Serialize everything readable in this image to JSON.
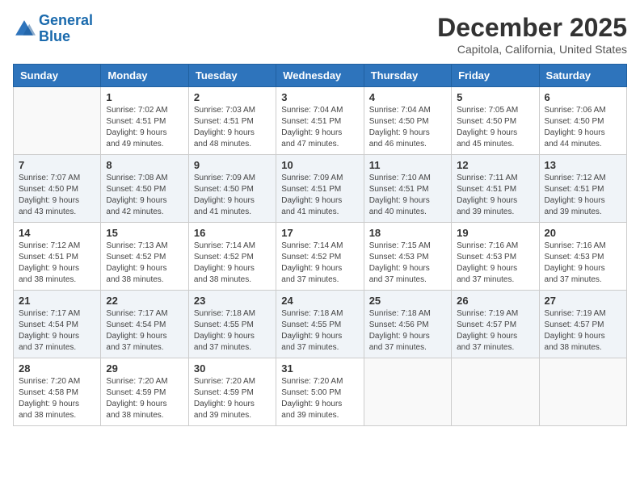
{
  "logo": {
    "line1": "General",
    "line2": "Blue"
  },
  "title": "December 2025",
  "subtitle": "Capitola, California, United States",
  "weekdays": [
    "Sunday",
    "Monday",
    "Tuesday",
    "Wednesday",
    "Thursday",
    "Friday",
    "Saturday"
  ],
  "weeks": [
    [
      {
        "day": "",
        "info": ""
      },
      {
        "day": "1",
        "info": "Sunrise: 7:02 AM\nSunset: 4:51 PM\nDaylight: 9 hours\nand 49 minutes."
      },
      {
        "day": "2",
        "info": "Sunrise: 7:03 AM\nSunset: 4:51 PM\nDaylight: 9 hours\nand 48 minutes."
      },
      {
        "day": "3",
        "info": "Sunrise: 7:04 AM\nSunset: 4:51 PM\nDaylight: 9 hours\nand 47 minutes."
      },
      {
        "day": "4",
        "info": "Sunrise: 7:04 AM\nSunset: 4:50 PM\nDaylight: 9 hours\nand 46 minutes."
      },
      {
        "day": "5",
        "info": "Sunrise: 7:05 AM\nSunset: 4:50 PM\nDaylight: 9 hours\nand 45 minutes."
      },
      {
        "day": "6",
        "info": "Sunrise: 7:06 AM\nSunset: 4:50 PM\nDaylight: 9 hours\nand 44 minutes."
      }
    ],
    [
      {
        "day": "7",
        "info": "Sunrise: 7:07 AM\nSunset: 4:50 PM\nDaylight: 9 hours\nand 43 minutes."
      },
      {
        "day": "8",
        "info": "Sunrise: 7:08 AM\nSunset: 4:50 PM\nDaylight: 9 hours\nand 42 minutes."
      },
      {
        "day": "9",
        "info": "Sunrise: 7:09 AM\nSunset: 4:50 PM\nDaylight: 9 hours\nand 41 minutes."
      },
      {
        "day": "10",
        "info": "Sunrise: 7:09 AM\nSunset: 4:51 PM\nDaylight: 9 hours\nand 41 minutes."
      },
      {
        "day": "11",
        "info": "Sunrise: 7:10 AM\nSunset: 4:51 PM\nDaylight: 9 hours\nand 40 minutes."
      },
      {
        "day": "12",
        "info": "Sunrise: 7:11 AM\nSunset: 4:51 PM\nDaylight: 9 hours\nand 39 minutes."
      },
      {
        "day": "13",
        "info": "Sunrise: 7:12 AM\nSunset: 4:51 PM\nDaylight: 9 hours\nand 39 minutes."
      }
    ],
    [
      {
        "day": "14",
        "info": "Sunrise: 7:12 AM\nSunset: 4:51 PM\nDaylight: 9 hours\nand 38 minutes."
      },
      {
        "day": "15",
        "info": "Sunrise: 7:13 AM\nSunset: 4:52 PM\nDaylight: 9 hours\nand 38 minutes."
      },
      {
        "day": "16",
        "info": "Sunrise: 7:14 AM\nSunset: 4:52 PM\nDaylight: 9 hours\nand 38 minutes."
      },
      {
        "day": "17",
        "info": "Sunrise: 7:14 AM\nSunset: 4:52 PM\nDaylight: 9 hours\nand 37 minutes."
      },
      {
        "day": "18",
        "info": "Sunrise: 7:15 AM\nSunset: 4:53 PM\nDaylight: 9 hours\nand 37 minutes."
      },
      {
        "day": "19",
        "info": "Sunrise: 7:16 AM\nSunset: 4:53 PM\nDaylight: 9 hours\nand 37 minutes."
      },
      {
        "day": "20",
        "info": "Sunrise: 7:16 AM\nSunset: 4:53 PM\nDaylight: 9 hours\nand 37 minutes."
      }
    ],
    [
      {
        "day": "21",
        "info": "Sunrise: 7:17 AM\nSunset: 4:54 PM\nDaylight: 9 hours\nand 37 minutes."
      },
      {
        "day": "22",
        "info": "Sunrise: 7:17 AM\nSunset: 4:54 PM\nDaylight: 9 hours\nand 37 minutes."
      },
      {
        "day": "23",
        "info": "Sunrise: 7:18 AM\nSunset: 4:55 PM\nDaylight: 9 hours\nand 37 minutes."
      },
      {
        "day": "24",
        "info": "Sunrise: 7:18 AM\nSunset: 4:55 PM\nDaylight: 9 hours\nand 37 minutes."
      },
      {
        "day": "25",
        "info": "Sunrise: 7:18 AM\nSunset: 4:56 PM\nDaylight: 9 hours\nand 37 minutes."
      },
      {
        "day": "26",
        "info": "Sunrise: 7:19 AM\nSunset: 4:57 PM\nDaylight: 9 hours\nand 37 minutes."
      },
      {
        "day": "27",
        "info": "Sunrise: 7:19 AM\nSunset: 4:57 PM\nDaylight: 9 hours\nand 38 minutes."
      }
    ],
    [
      {
        "day": "28",
        "info": "Sunrise: 7:20 AM\nSunset: 4:58 PM\nDaylight: 9 hours\nand 38 minutes."
      },
      {
        "day": "29",
        "info": "Sunrise: 7:20 AM\nSunset: 4:59 PM\nDaylight: 9 hours\nand 38 minutes."
      },
      {
        "day": "30",
        "info": "Sunrise: 7:20 AM\nSunset: 4:59 PM\nDaylight: 9 hours\nand 39 minutes."
      },
      {
        "day": "31",
        "info": "Sunrise: 7:20 AM\nSunset: 5:00 PM\nDaylight: 9 hours\nand 39 minutes."
      },
      {
        "day": "",
        "info": ""
      },
      {
        "day": "",
        "info": ""
      },
      {
        "day": "",
        "info": ""
      }
    ]
  ]
}
